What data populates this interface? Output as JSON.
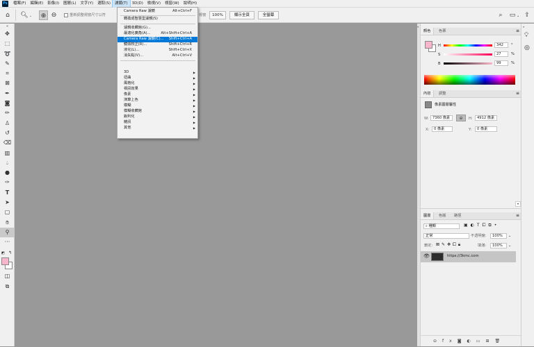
{
  "app": {
    "logo": "Ps"
  },
  "menubar": {
    "items": [
      "檔案(F)",
      "編輯(E)",
      "影像(I)",
      "圖層(L)",
      "文字(Y)",
      "選取(S)",
      "濾鏡(T)",
      "3D(D)",
      "檢視(V)",
      "視窗(W)",
      "說明(H)"
    ],
    "active_index": 6
  },
  "options_bar": {
    "checkbox_label": "重新調整視窗尺寸以符",
    "partial_label": "視窗",
    "zoom_value": "100%",
    "fit_screen": "顯示全頁",
    "fill_screen": "全螢幕"
  },
  "filter_menu": {
    "top_item": {
      "label": "Camera Raw 濾鏡",
      "shortcut": "Alt+Ctrl+F"
    },
    "convert_smart": "轉換成智慧型濾鏡(S)",
    "items": [
      {
        "label": "濾鏡收藏館(G)...",
        "shortcut": ""
      },
      {
        "label": "最適化廣角(A)...",
        "shortcut": "Alt+Shift+Ctrl+A"
      },
      {
        "label": "Camera Raw 濾鏡(C)...",
        "shortcut": "Shift+Ctrl+A"
      },
      {
        "label": "鏡頭校正(R)...",
        "shortcut": "Shift+Ctrl+R"
      },
      {
        "label": "液化(L)...",
        "shortcut": "Shift+Ctrl+X"
      },
      {
        "label": "消失點(V)...",
        "shortcut": "Alt+Ctrl+V"
      }
    ],
    "submenus": [
      "3D",
      "扭曲",
      "風格化",
      "視訊效果",
      "像素",
      "演算上色",
      "模糊",
      "模糊收藏館",
      "銳利化",
      "雜訊",
      "其他"
    ]
  },
  "color_panel": {
    "tabs": [
      "顏色",
      "色票"
    ],
    "sliders": [
      {
        "label": "H",
        "value": "342",
        "unit": "°"
      },
      {
        "label": "S",
        "value": "27",
        "unit": "%"
      },
      {
        "label": "B",
        "value": "99",
        "unit": "%"
      }
    ]
  },
  "properties_panel": {
    "tabs": [
      "內容",
      "調整"
    ],
    "title": "像素圖層屬性",
    "w_label": "W:",
    "w_value": "7360 像素",
    "h_label": "H:",
    "h_value": "4912 像素",
    "x_label": "X:",
    "x_value": "0 像素",
    "y_label": "Y:",
    "y_value": "0 像素"
  },
  "layers_panel": {
    "tabs": [
      "圖層",
      "色版",
      "路徑"
    ],
    "filter": "種類",
    "blend_mode": "正常",
    "opacity_label": "不透明度:",
    "opacity_value": "100%",
    "lock_label": "鎖定:",
    "fill_label": "填滿:",
    "fill_value": "100%",
    "layer_name": "https://3kmc.com"
  },
  "colors": {
    "foreground": "#f7b6c9",
    "background": "#ffffff",
    "highlight": "#0078d7"
  }
}
